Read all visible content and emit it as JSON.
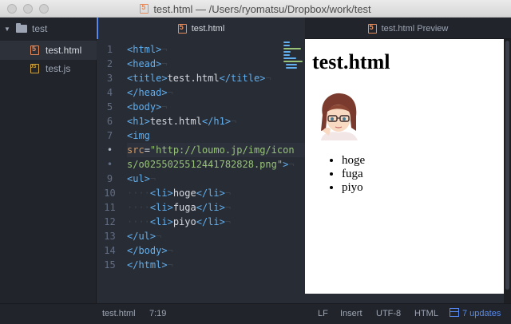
{
  "window": {
    "title": "test.html — /Users/ryomatsu/Dropbox/work/test"
  },
  "tree": {
    "root": "test",
    "items": [
      {
        "label": "test.html",
        "selected": true
      },
      {
        "label": "test.js",
        "selected": false
      }
    ]
  },
  "tabs": {
    "editor_tab": "test.html",
    "preview_tab": "test.html Preview"
  },
  "editor": {
    "line_numbers": [
      "1",
      "2",
      "3",
      "4",
      "5",
      "6",
      "7",
      "•",
      "•",
      "9",
      "10",
      "11",
      "12",
      "13",
      "14",
      "15"
    ],
    "current_line_index": 7
  },
  "preview": {
    "heading": "test.html",
    "list": [
      "hoge",
      "fuga",
      "piyo"
    ]
  },
  "status": {
    "file": "test.html",
    "cursor": "7:19",
    "line_ending": "LF",
    "mode": "Insert",
    "encoding": "UTF-8",
    "grammar": "HTML",
    "updates": "7 updates"
  },
  "colors": {
    "accent": "#568af2",
    "editor_bg": "#282c34",
    "panel_bg": "#21252b"
  }
}
